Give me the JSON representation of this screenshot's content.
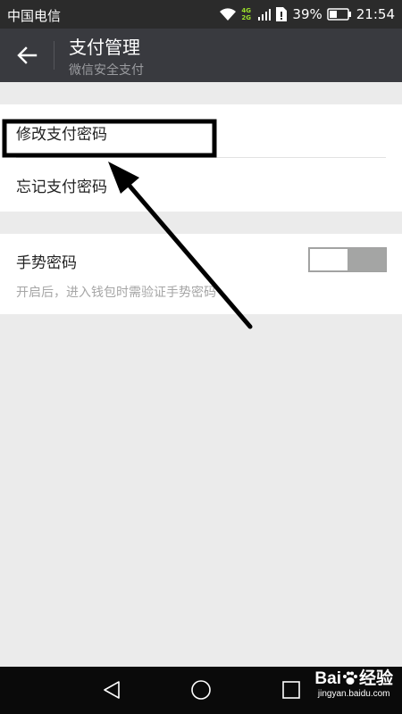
{
  "status_bar": {
    "carrier": "中国电信",
    "network_badge_top": "4G",
    "network_badge_bottom": "2G",
    "battery_percent": "39%",
    "time": "21:54",
    "icons": [
      "wifi-icon",
      "signal-icon",
      "sim-card-icon",
      "battery-icon"
    ]
  },
  "app_bar": {
    "title": "支付管理",
    "subtitle": "微信安全支付",
    "back_icon": "arrow-left-icon"
  },
  "settings": {
    "change_password_label": "修改支付密码",
    "forgot_password_label": "忘记支付密码",
    "gesture_password": {
      "label": "手势密码",
      "description": "开启后，进入钱包时需验证手势密码",
      "enabled": false
    }
  },
  "nav_bar": {
    "icons": [
      "back-triangle-icon",
      "home-circle-icon",
      "recents-square-icon"
    ]
  },
  "watermark": {
    "logo_left": "Bai",
    "logo_right": "经验",
    "url": "jingyan.baidu.com"
  },
  "colors": {
    "status_bar_bg": "#2b2b2b",
    "app_bar_bg": "#393a3f",
    "page_bg": "#ebebeb",
    "toggle_off": "#a4a5a4",
    "network_badge": "#9be02a"
  }
}
